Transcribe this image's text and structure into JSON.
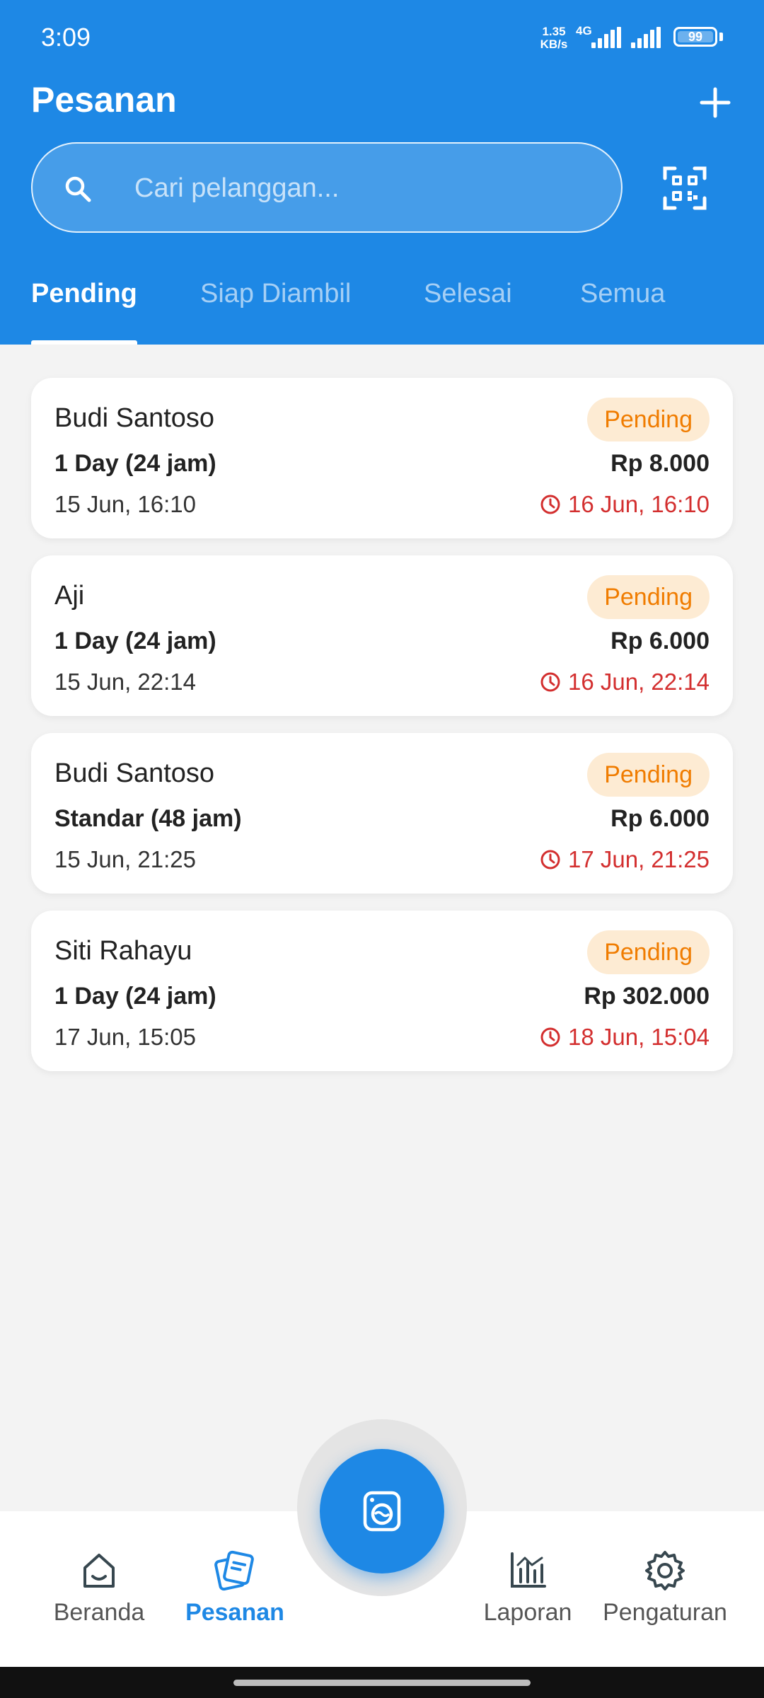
{
  "status_bar": {
    "time": "3:09",
    "net_speed_value": "1.35",
    "net_speed_unit": "KB/s",
    "net_type": "4G",
    "battery": "99"
  },
  "header": {
    "title": "Pesanan",
    "add_icon": "plus-icon",
    "qr_icon": "qr-scan-icon",
    "search": {
      "placeholder": "Cari pelanggan...",
      "value": ""
    }
  },
  "tabs": [
    {
      "label": "Pending",
      "active": true
    },
    {
      "label": "Siap Diambil",
      "active": false
    },
    {
      "label": "Selesai",
      "active": false
    },
    {
      "label": "Semua",
      "active": false
    }
  ],
  "orders": [
    {
      "name": "Budi Santoso",
      "status": "Pending",
      "service": "1 Day (24 jam)",
      "price": "Rp 8.000",
      "created": "15 Jun, 16:10",
      "due": "16 Jun, 16:10"
    },
    {
      "name": "Aji",
      "status": "Pending",
      "service": "1 Day (24 jam)",
      "price": "Rp 6.000",
      "created": "15 Jun, 22:14",
      "due": "16 Jun, 22:14"
    },
    {
      "name": "Budi Santoso",
      "status": "Pending",
      "service": "Standar (48 jam)",
      "price": "Rp 6.000",
      "created": "15 Jun, 21:25",
      "due": "17 Jun, 21:25"
    },
    {
      "name": "Siti Rahayu",
      "status": "Pending",
      "service": "1 Day (24 jam)",
      "price": "Rp 302.000",
      "created": "17 Jun, 15:05",
      "due": "18 Jun, 15:04"
    }
  ],
  "bottom_nav": [
    {
      "label": "Beranda",
      "icon": "home-icon",
      "active": false
    },
    {
      "label": "Pesanan",
      "icon": "orders-icon",
      "active": true
    },
    {
      "label": "Laporan",
      "icon": "chart-icon",
      "active": false
    },
    {
      "label": "Pengaturan",
      "icon": "gear-icon",
      "active": false
    }
  ],
  "fab": {
    "icon": "washing-machine-icon"
  },
  "colors": {
    "primary": "#1e88e5",
    "pending_text": "#f07c00",
    "pending_bg": "#fdebd3",
    "due_red": "#d32f2f",
    "background": "#f3f3f3"
  }
}
